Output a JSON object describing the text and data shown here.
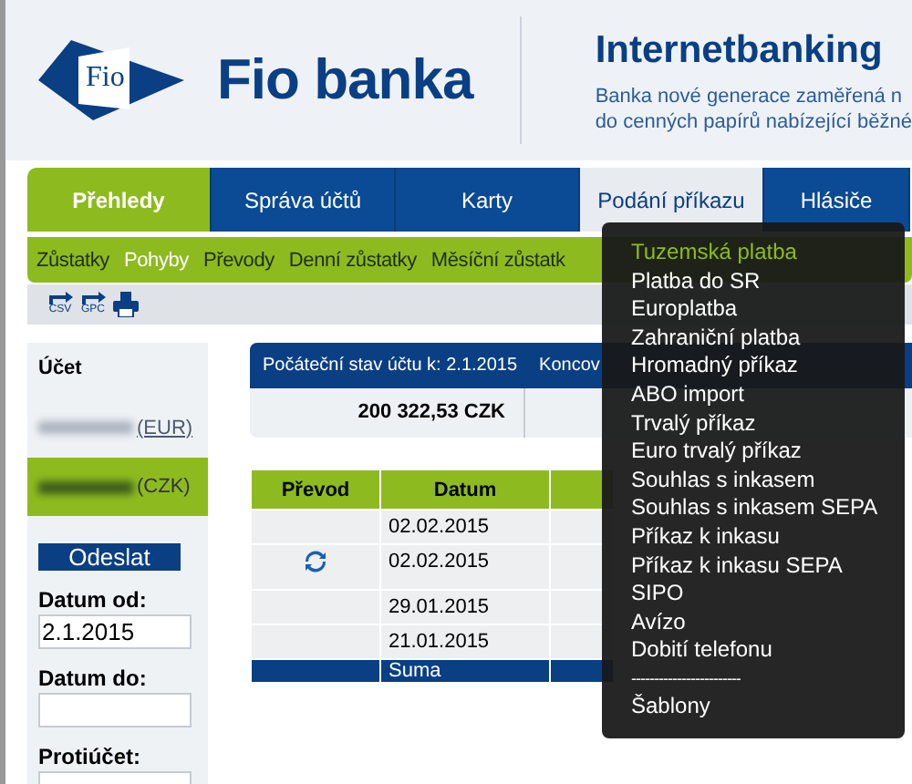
{
  "header": {
    "bank_name": "Fio banka",
    "logo_text": "Fio",
    "title": "Internetbanking",
    "tagline": [
      "Banka nové generace zaměřená n",
      "do cenných papírů nabízející běžné"
    ]
  },
  "tabs": [
    {
      "label": "Přehledy",
      "selected": true
    },
    {
      "label": "Správa účtů",
      "selected": false
    },
    {
      "label": "Karty",
      "selected": false
    },
    {
      "label": "Podání příkazu",
      "selected": false,
      "open": true
    },
    {
      "label": "Hlásiče",
      "selected": false
    }
  ],
  "subnav": [
    {
      "label": "Zůstatky",
      "selected": false
    },
    {
      "label": "Pohyby",
      "selected": true
    },
    {
      "label": "Převody",
      "selected": false
    },
    {
      "label": "Denní zůstatky",
      "selected": false
    },
    {
      "label": "Měsíční zůstatk",
      "selected": false
    }
  ],
  "toolbar": [
    {
      "kind": "export",
      "label": "CSV"
    },
    {
      "kind": "export",
      "label": "GPC"
    },
    {
      "kind": "print"
    }
  ],
  "sidebar": {
    "account_label": "Účet",
    "accounts": [
      {
        "currency": "(EUR)",
        "selected": false
      },
      {
        "currency": "(CZK)",
        "selected": true
      }
    ],
    "send_button": "Odeslat",
    "fields": [
      {
        "label": "Datum od:",
        "value": "2.1.2015"
      },
      {
        "label": "Datum do:"
      },
      {
        "label": "Protiúčet:"
      }
    ]
  },
  "summary": {
    "columns": [
      "Počáteční stav účtu k: 2.1.2015",
      "Koncov"
    ],
    "values": [
      "200 322,53 CZK"
    ]
  },
  "table": {
    "columns": [
      "Převod",
      "Datum"
    ],
    "rows": [
      {
        "transfer": false,
        "date": "02.02.2015"
      },
      {
        "transfer": true,
        "date": "02.02.2015"
      },
      {
        "transfer": false,
        "date": "29.01.2015"
      },
      {
        "transfer": false,
        "date": "21.01.2015"
      }
    ],
    "footer": "Suma"
  },
  "menu": {
    "items": [
      {
        "kind": "item",
        "label": "Tuzemská platba",
        "selected": true
      },
      {
        "kind": "item",
        "label": "Platba do SR",
        "selected": false
      },
      {
        "kind": "item",
        "label": "Europlatba",
        "selected": false
      },
      {
        "kind": "item",
        "label": "Zahraniční platba",
        "selected": false
      },
      {
        "kind": "item",
        "label": "Hromadný příkaz",
        "selected": false
      },
      {
        "kind": "item",
        "label": "ABO import",
        "selected": false
      },
      {
        "kind": "item",
        "label": "Trvalý příkaz",
        "selected": false
      },
      {
        "kind": "item",
        "label": "Euro trvalý příkaz",
        "selected": false
      },
      {
        "kind": "item",
        "label": "Souhlas s inkasem",
        "selected": false
      },
      {
        "kind": "item",
        "label": "Souhlas s inkasem SEPA",
        "selected": false
      },
      {
        "kind": "item",
        "label": "Příkaz k inkasu",
        "selected": false
      },
      {
        "kind": "item",
        "label": "Příkaz k inkasu SEPA",
        "selected": false
      },
      {
        "kind": "item",
        "label": "SIPO",
        "selected": false
      },
      {
        "kind": "item",
        "label": "Avízo",
        "selected": false
      },
      {
        "kind": "item",
        "label": "Dobití telefonu",
        "selected": false
      },
      {
        "kind": "separator",
        "label": "------------------------"
      },
      {
        "kind": "item",
        "label": "Šablony",
        "selected": false
      }
    ]
  }
}
